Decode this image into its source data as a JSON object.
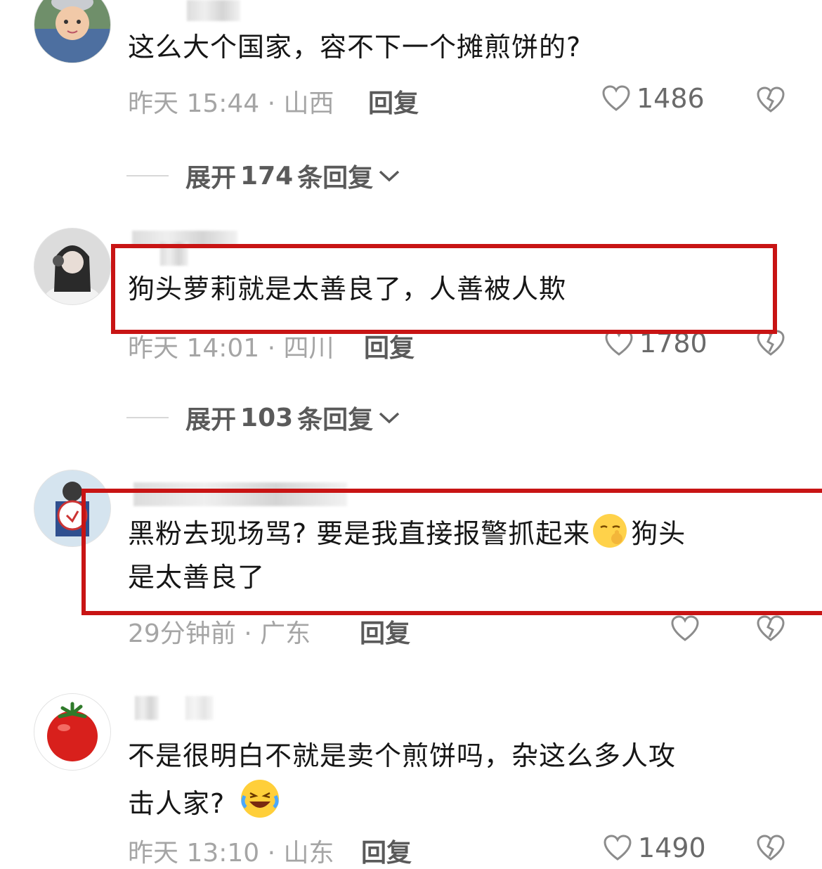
{
  "comments": [
    {
      "text_lines": [
        "这么大个国家，容不下一个摊煎饼的?"
      ],
      "meta": "昨天 15:44 · 山西",
      "reply_label": "回复",
      "likes": "1486",
      "expand": {
        "prefix": "展开",
        "count": "174",
        "suffix": "条回复"
      }
    },
    {
      "text_lines": [
        "狗头萝莉就是太善良了，人善被人欺"
      ],
      "meta": "昨天 14:01 · 四川",
      "reply_label": "回复",
      "likes": "1780",
      "expand": {
        "prefix": "展开",
        "count": "103",
        "suffix": "条回复"
      }
    },
    {
      "text_line1_a": "黑粉去现场骂? 要是我直接报警抓起来",
      "text_line1_b": "狗头",
      "text_line2": "是太善良了",
      "meta": "29分钟前 · 广东",
      "reply_label": "回复"
    },
    {
      "text_lines": [
        "不是很明白不就是卖个煎饼吗，杂这么多人攻",
        "击人家?"
      ],
      "meta": "昨天 13:10 · 山东",
      "reply_label": "回复",
      "likes": "1490"
    }
  ],
  "colors": {
    "highlight_box": "#c81414",
    "meta_text": "#a5a5a5"
  },
  "icons": [
    "heart-outline-icon",
    "broken-heart-icon",
    "chevron-down-icon",
    "shush-emoji-icon",
    "laughing-crying-emoji-icon"
  ]
}
